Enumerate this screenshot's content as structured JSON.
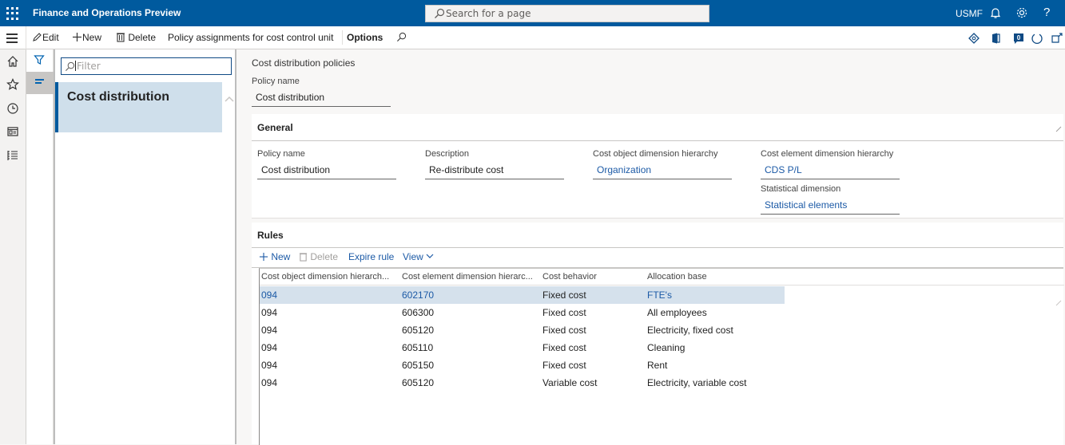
{
  "topbar": {
    "app_title": "Finance and Operations Preview",
    "search_placeholder": "Search for a page",
    "company": "USMF",
    "icons": [
      "waffle-icon",
      "bell-icon",
      "gear-icon",
      "help-icon"
    ]
  },
  "actionbar": {
    "edit": "Edit",
    "new": "New",
    "delete": "Delete",
    "policy_assignments": "Policy assignments for cost control unit",
    "options": "Options",
    "right_icons": [
      "diamond-icon",
      "office-icon",
      "notification-badge-icon",
      "refresh-icon",
      "popout-icon"
    ],
    "notification_count": "0"
  },
  "navrail": {
    "items": [
      "home",
      "favorites",
      "recent",
      "workspaces",
      "modules"
    ]
  },
  "listpane": {
    "filter_placeholder": "Filter",
    "items": [
      {
        "title": "Cost distribution",
        "selected": true
      }
    ]
  },
  "content": {
    "caption": "Cost distribution policies",
    "policy_name_label": "Policy name",
    "policy_name_value": "Cost distribution",
    "general": {
      "header": "General",
      "fields": {
        "policy_name": {
          "label": "Policy name",
          "value": "Cost distribution"
        },
        "description": {
          "label": "Description",
          "value": "Re-distribute cost"
        },
        "cost_object_hierarchy": {
          "label": "Cost object dimension hierarchy",
          "value": "Organization"
        },
        "cost_element_hierarchy": {
          "label": "Cost element dimension hierarchy",
          "value": "CDS P/L"
        },
        "statistical_dimension": {
          "label": "Statistical dimension",
          "value": "Statistical elements"
        }
      }
    },
    "rules": {
      "header": "Rules",
      "toolbar": {
        "new": "New",
        "delete": "Delete",
        "expire_rule": "Expire rule",
        "view": "View"
      },
      "columns": [
        "Cost object dimension hierarch...",
        "Cost element dimension hierarc...",
        "Cost behavior",
        "Allocation base"
      ],
      "rows": [
        {
          "cost_object": "094",
          "cost_element": "602170",
          "behavior": "Fixed cost",
          "allocation": "FTE's",
          "selected": true
        },
        {
          "cost_object": "094",
          "cost_element": "606300",
          "behavior": "Fixed cost",
          "allocation": "All employees"
        },
        {
          "cost_object": "094",
          "cost_element": "605120",
          "behavior": "Fixed cost",
          "allocation": "Electricity, fixed cost"
        },
        {
          "cost_object": "094",
          "cost_element": "605110",
          "behavior": "Fixed cost",
          "allocation": "Cleaning"
        },
        {
          "cost_object": "094",
          "cost_element": "605150",
          "behavior": "Fixed cost",
          "allocation": "Rent"
        },
        {
          "cost_object": "094",
          "cost_element": "605120",
          "behavior": "Variable cost",
          "allocation": "Electricity, variable cost"
        }
      ]
    }
  }
}
